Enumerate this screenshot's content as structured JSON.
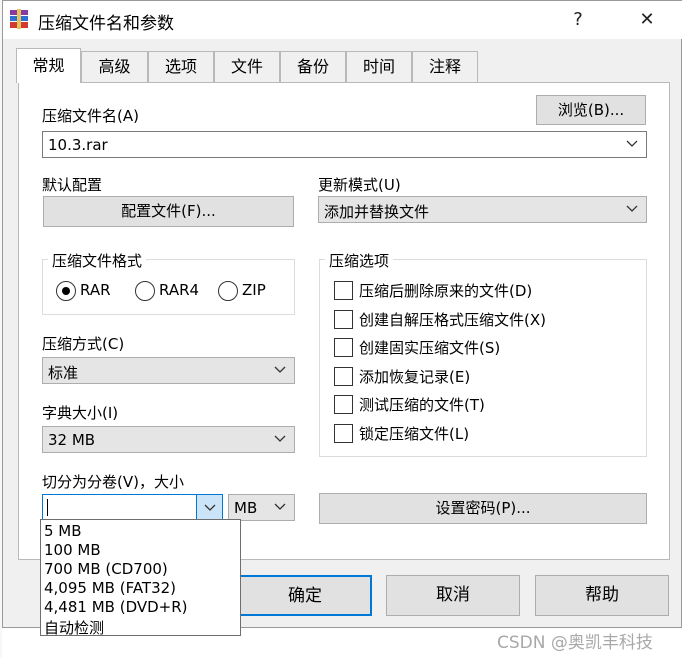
{
  "window": {
    "title": "压缩文件名和参数",
    "help_glyph": "?",
    "close_glyph": "✕"
  },
  "tabs": [
    {
      "label": "常规",
      "active": true
    },
    {
      "label": "高级"
    },
    {
      "label": "选项"
    },
    {
      "label": "文件"
    },
    {
      "label": "备份"
    },
    {
      "label": "时间"
    },
    {
      "label": "注释"
    }
  ],
  "archive_name": {
    "label": "压缩文件名(A)",
    "browse_label": "浏览(B)...",
    "value": "10.3.rar"
  },
  "profile": {
    "label": "默认配置",
    "button_label": "配置文件(F)..."
  },
  "update_mode": {
    "label": "更新模式(U)",
    "value": "添加并替换文件"
  },
  "format": {
    "title": "压缩文件格式",
    "options": [
      {
        "label": "RAR",
        "checked": true
      },
      {
        "label": "RAR4",
        "checked": false
      },
      {
        "label": "ZIP",
        "checked": false
      }
    ]
  },
  "compression_options": {
    "title": "压缩选项",
    "items": [
      {
        "label": "压缩后删除原来的文件(D)",
        "checked": false
      },
      {
        "label": "创建自解压格式压缩文件(X)",
        "checked": false
      },
      {
        "label": "创建固实压缩文件(S)",
        "checked": false
      },
      {
        "label": "添加恢复记录(E)",
        "checked": false
      },
      {
        "label": "测试压缩的文件(T)",
        "checked": false
      },
      {
        "label": "锁定压缩文件(L)",
        "checked": false
      }
    ]
  },
  "method": {
    "label": "压缩方式(C)",
    "value": "标准"
  },
  "dictionary": {
    "label": "字典大小(I)",
    "value": "32 MB"
  },
  "split": {
    "label": "切分为分卷(V)，大小",
    "value": "",
    "unit": "MB",
    "options": [
      "5 MB",
      "100 MB",
      "700 MB  (CD700)",
      "4,095 MB  (FAT32)",
      "4,481 MB  (DVD+R)",
      "自动检测"
    ]
  },
  "password_button_label": "设置密码(P)...",
  "buttons": {
    "ok": "确定",
    "cancel": "取消",
    "help": "帮助"
  },
  "watermark": "CSDN @奥凯丰科技"
}
